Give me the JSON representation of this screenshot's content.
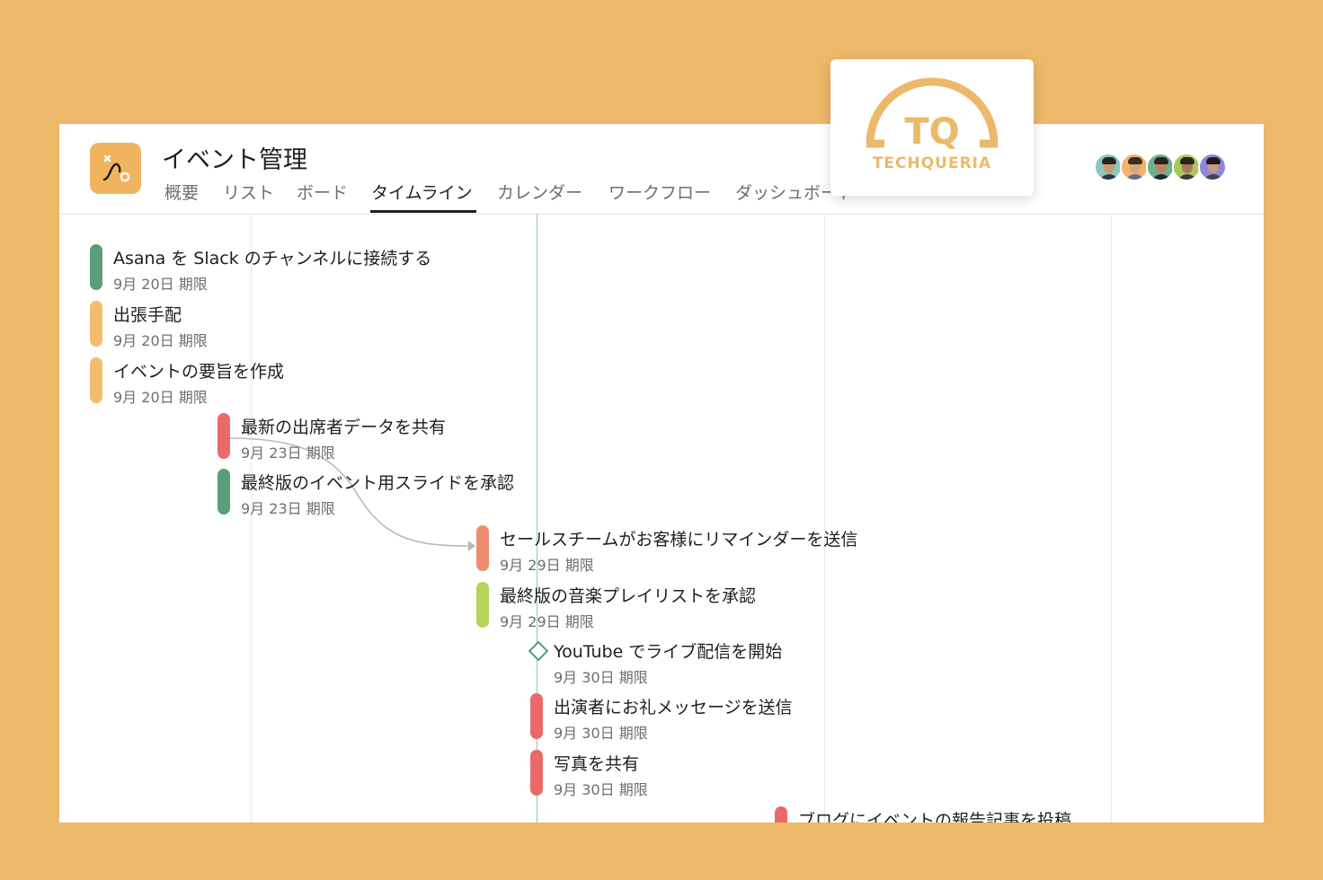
{
  "project": {
    "title": "イベント管理",
    "icon": "timeline-route-icon",
    "icon_color": "#f0b45f"
  },
  "tabs": [
    {
      "label": "概要",
      "active": false
    },
    {
      "label": "リスト",
      "active": false
    },
    {
      "label": "ボード",
      "active": false
    },
    {
      "label": "タイムライン",
      "active": true
    },
    {
      "label": "カレンダー",
      "active": false
    },
    {
      "label": "ワークフロー",
      "active": false
    },
    {
      "label": "ダッシュボード",
      "active": false
    }
  ],
  "members": [
    "avatar-1",
    "avatar-2",
    "avatar-3",
    "avatar-4",
    "avatar-5"
  ],
  "tasks": [
    {
      "title": "Asana を Slack のチャンネルに接続する",
      "due": "9月 20日 期限",
      "color": "#5a9e7c"
    },
    {
      "title": "出張手配",
      "due": "9月 20日 期限",
      "color": "#f1bd6c"
    },
    {
      "title": "イベントの要旨を作成",
      "due": "9月 20日 期限",
      "color": "#f1bd6c"
    },
    {
      "title": "最新の出席者データを共有",
      "due": "9月 23日 期限",
      "color": "#ea6a6a"
    },
    {
      "title": "最終版のイベント用スライドを承認",
      "due": "9月 23日 期限",
      "color": "#5a9e7c"
    },
    {
      "title": "セールスチームがお客様にリマインダーを送信",
      "due": "9月 29日 期限",
      "color": "#f08c70"
    },
    {
      "title": "最終版の音楽プレイリストを承認",
      "due": "9月 29日 期限",
      "color": "#b6d35a"
    },
    {
      "title": "YouTube でライブ配信を開始",
      "due": "9月 30日 期限",
      "type": "milestone",
      "color": "#4f9e87"
    },
    {
      "title": "出演者にお礼メッセージを送信",
      "due": "9月 30日 期限",
      "color": "#ea6a6a"
    },
    {
      "title": "写真を共有",
      "due": "9月 30日 期限",
      "color": "#ea6a6a"
    },
    {
      "title": "ブログにイベントの報告記事を投稿",
      "due": "",
      "color": "#ea6a6a"
    }
  ],
  "overlay_logo": {
    "text": "TECHQUERIA",
    "monogram": "TQ",
    "color": "#ecb869"
  }
}
